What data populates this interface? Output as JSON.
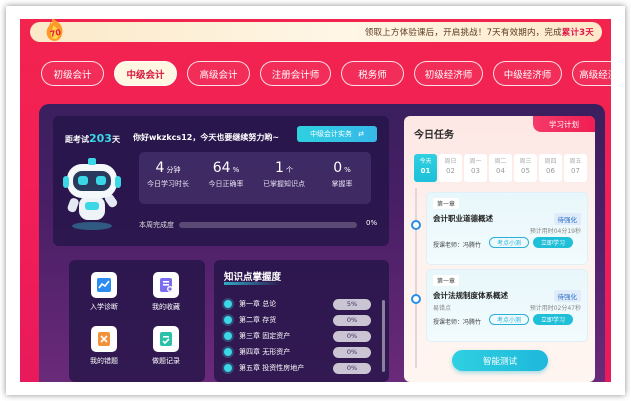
{
  "banner": {
    "text_prefix": "领取上方体验课后，开启挑战！7天有效期内，完成",
    "text_highlight": "累计3天"
  },
  "tabs": [
    {
      "label": "初级会计",
      "active": false
    },
    {
      "label": "中级会计",
      "active": true
    },
    {
      "label": "高级会计",
      "active": false
    },
    {
      "label": "注册会计师",
      "active": false
    },
    {
      "label": "税务师",
      "active": false
    },
    {
      "label": "初级经济师",
      "active": false
    },
    {
      "label": "中级经济师",
      "active": false
    },
    {
      "label": "高级经济师",
      "active": false
    }
  ],
  "stats_card": {
    "countdown_prefix": "距考试",
    "countdown_days": "203",
    "countdown_suffix": "天",
    "greeting": "你好wkzkcs12，今天也要继续努力哟~",
    "practice_button": "中级会计实务",
    "switch_icon": "switch-icon",
    "stats": [
      {
        "value": "4",
        "unit": "分钟",
        "label": "今日学习时长"
      },
      {
        "value": "64",
        "unit": "%",
        "label": "今日正确率"
      },
      {
        "value": "1",
        "unit": "个",
        "label": "已掌握知识点"
      },
      {
        "value": "0",
        "unit": "%",
        "label": "掌握率"
      }
    ],
    "progress_label": "本周完成度",
    "progress_value": "0%",
    "progress_fraction": 0
  },
  "quick_access": [
    {
      "label": "入学诊断",
      "icon": "chart-line-icon",
      "color": "#2c8cf0"
    },
    {
      "label": "我的收藏",
      "icon": "collection-icon",
      "color": "#7b6cf0"
    },
    {
      "label": "我的错题",
      "icon": "wrong-question-icon",
      "color": "#f2923a"
    },
    {
      "label": "做题记录",
      "icon": "record-icon",
      "color": "#2bc0a8"
    }
  ],
  "knowledge": {
    "title": "知识点掌握度",
    "items": [
      {
        "name": "第一章 总论",
        "pct": "5%"
      },
      {
        "name": "第二章 存货",
        "pct": "0%"
      },
      {
        "name": "第三章 固定资产",
        "pct": "0%"
      },
      {
        "name": "第四章 无形资产",
        "pct": "0%"
      },
      {
        "name": "第五章 投资性房地产",
        "pct": "0%"
      }
    ]
  },
  "today": {
    "title": "今日任务",
    "plan_tag": "学习计划",
    "week": [
      {
        "day": "今天",
        "date": "01",
        "active": true
      },
      {
        "day": "周日",
        "date": "02",
        "active": false
      },
      {
        "day": "周一",
        "date": "03",
        "active": false
      },
      {
        "day": "周二",
        "date": "04",
        "active": false
      },
      {
        "day": "周三",
        "date": "05",
        "active": false
      },
      {
        "day": "周四",
        "date": "06",
        "active": false
      },
      {
        "day": "周五",
        "date": "07",
        "active": false
      }
    ],
    "tasks": [
      {
        "chapter": "第一章",
        "title": "会计职业道德概述",
        "state": "待强化",
        "sub": "",
        "time": "预计用时04分19秒",
        "teacher": "授课老师：冯腾竹",
        "kp_button": "考点小测",
        "learn_button": "立即学习"
      },
      {
        "chapter": "第一章",
        "title": "会计法规制度体系概述",
        "state": "待强化",
        "sub": "易错点",
        "time": "预计用时02分47秒",
        "teacher": "授课老师：冯腾竹",
        "kp_button": "考点小测",
        "learn_button": "立即学习"
      }
    ],
    "smart_test_button": "智能测试"
  }
}
